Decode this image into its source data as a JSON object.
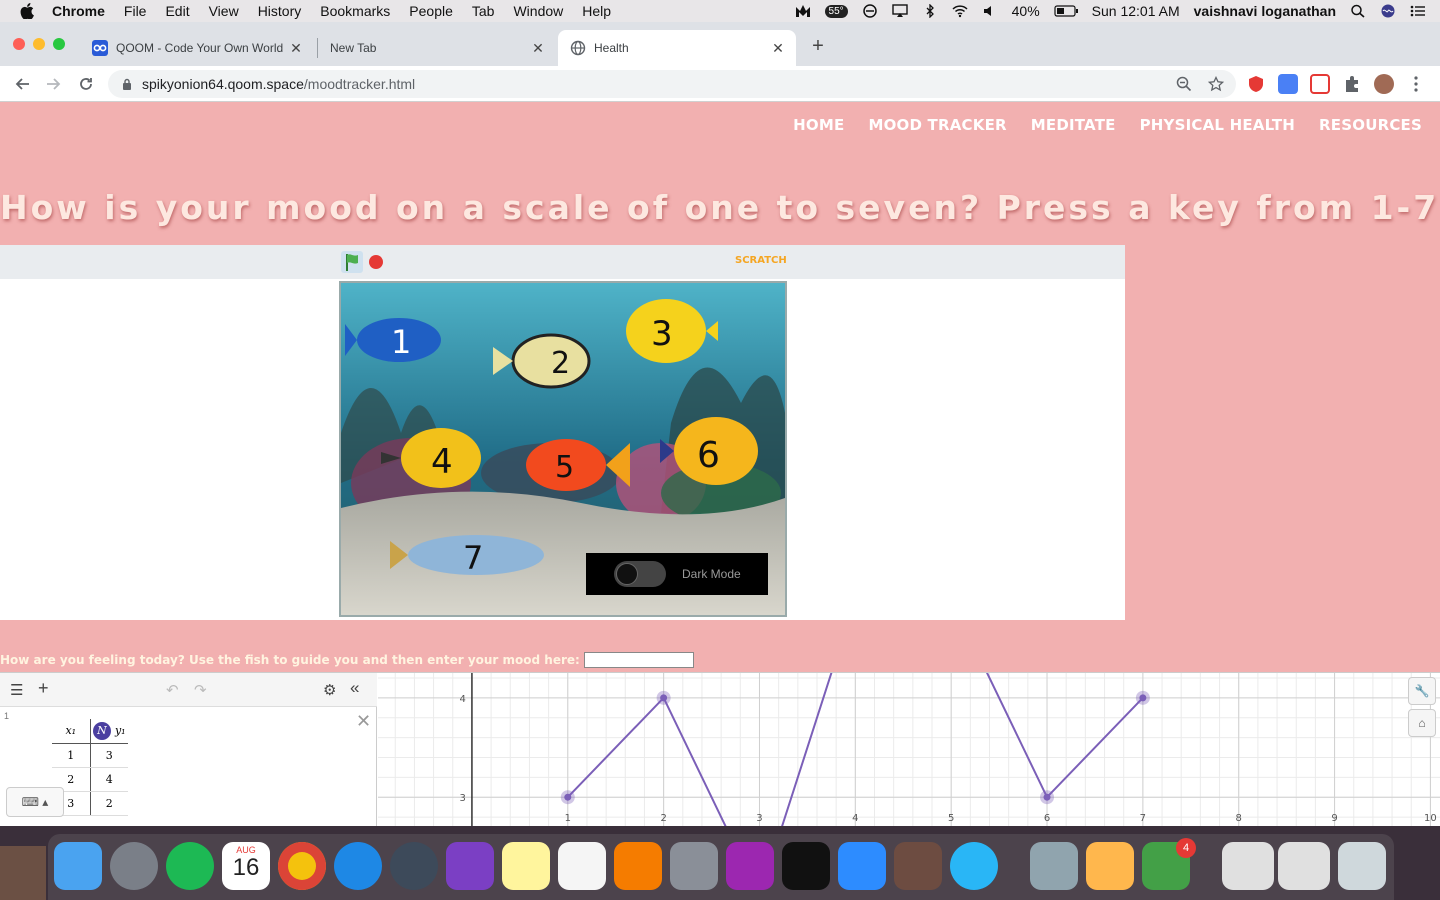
{
  "menubar": {
    "app": "Chrome",
    "items": [
      "File",
      "Edit",
      "View",
      "History",
      "Bookmarks",
      "People",
      "Tab",
      "Window",
      "Help"
    ],
    "temperature": "55°",
    "battery": "40%",
    "datetime": "Sun 12:01 AM",
    "user": "vaishnavi loganathan"
  },
  "tabs": [
    {
      "title": "QOOM - Code Your Own World",
      "icon": "qoom-icon"
    },
    {
      "title": "New Tab",
      "icon": ""
    },
    {
      "title": "Health",
      "icon": "globe-icon"
    }
  ],
  "toolbar": {
    "url_host": "spikyonion64.qoom.space",
    "url_path": "/moodtracker.html"
  },
  "page": {
    "nav": [
      "HOME",
      "MOOD TRACKER",
      "MEDITATE",
      "PHYSICAL HEALTH",
      "RESOURCES"
    ],
    "headline": "How is your mood on a scale of one to seven? Press a key from 1-7.",
    "scratch_logo": "SCRATCH",
    "dark_mode_label": "Dark Mode",
    "prompt": "How are you feeling today? Use the fish to guide you and then enter your mood here:",
    "mood_input_value": ""
  },
  "fish": [
    {
      "label": "1",
      "color": "#1f5fc4"
    },
    {
      "label": "2",
      "color": "#e8e0a0"
    },
    {
      "label": "3",
      "color": "#f5d21c"
    },
    {
      "label": "4",
      "color": "#f2c11a"
    },
    {
      "label": "5",
      "color": "#f24a1e"
    },
    {
      "label": "6",
      "color": "#f5b61c"
    },
    {
      "label": "7",
      "color": "#8fb5d8"
    }
  ],
  "desmos": {
    "row_label": "1",
    "table": {
      "headers": [
        "x₁",
        "y₁"
      ],
      "rows": [
        [
          "1",
          "3"
        ],
        [
          "2",
          "4"
        ],
        [
          "3",
          "2"
        ]
      ]
    }
  },
  "chart_data": {
    "type": "line",
    "x": [
      1,
      2,
      3,
      4,
      5,
      6,
      7
    ],
    "y": [
      3,
      4,
      2,
      5,
      5,
      3,
      4
    ],
    "xticks": [
      "1",
      "2",
      "3",
      "4",
      "5",
      "6",
      "7",
      "8",
      "9",
      "10"
    ],
    "yticks": [
      "3",
      "4"
    ],
    "xlim": [
      -0.98,
      10.1
    ],
    "ylim": [
      2.7,
      4.25
    ],
    "grid": true,
    "color": "#7b5fb8"
  },
  "dock": {
    "calendar_month": "AUG",
    "calendar_day": "16",
    "facetime_badge": "4"
  }
}
